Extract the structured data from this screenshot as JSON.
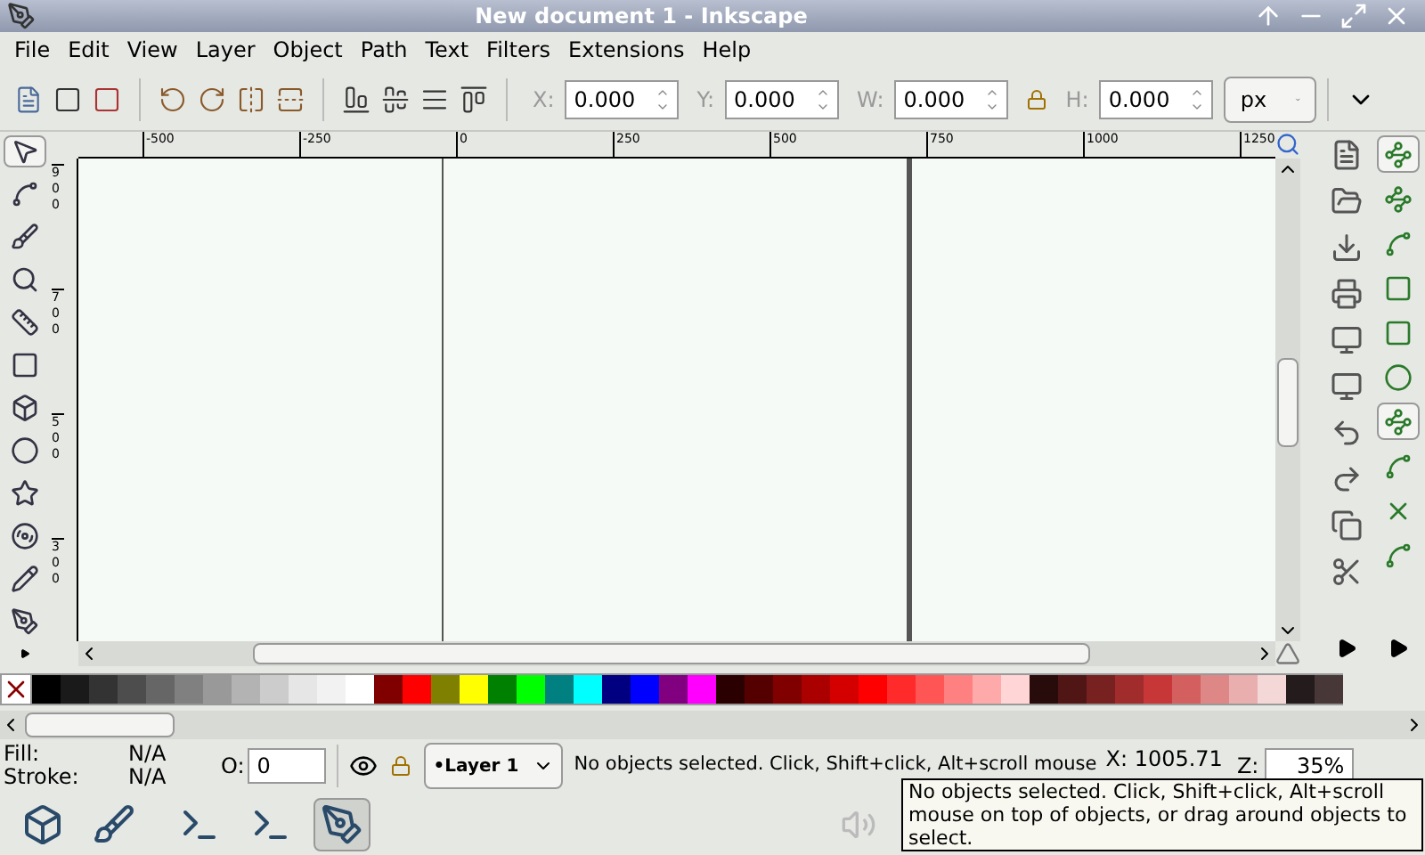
{
  "window": {
    "title": "New document 1 - Inkscape"
  },
  "menu": [
    "File",
    "Edit",
    "View",
    "Layer",
    "Object",
    "Path",
    "Text",
    "Filters",
    "Extensions",
    "Help"
  ],
  "toolbar": {
    "fields": [
      {
        "label": "X:",
        "value": "0.000"
      },
      {
        "label": "Y:",
        "value": "0.000"
      },
      {
        "label": "W:",
        "value": "0.000"
      },
      {
        "label": "H:",
        "value": "0.000"
      }
    ],
    "unit": "px"
  },
  "tools": [
    {
      "selected": true
    },
    {
      "selected": false
    },
    {
      "selected": false
    },
    {
      "selected": false
    },
    {
      "selected": false
    },
    {
      "selected": false
    },
    {
      "selected": false
    },
    {
      "selected": false
    },
    {
      "selected": false
    },
    {
      "selected": false
    },
    {
      "selected": false
    },
    {
      "selected": false
    }
  ],
  "ruler": {
    "horizontal": [
      "-500",
      "-250",
      "0",
      "250",
      "500",
      "750",
      "1000",
      "1250"
    ],
    "vertical": [
      "900",
      "700",
      "500",
      "300"
    ]
  },
  "snap": [
    {
      "selected": true
    },
    {
      "selected": false
    },
    {
      "selected": false
    },
    {
      "selected": false
    },
    {
      "selected": false
    },
    {
      "selected": false
    },
    {
      "selected": true
    },
    {
      "selected": false
    },
    {
      "selected": false
    },
    {
      "selected": false
    }
  ],
  "palette": [
    {
      "color": "#000000"
    },
    {
      "color": "#1a1a1a"
    },
    {
      "color": "#333333"
    },
    {
      "color": "#4d4d4d"
    },
    {
      "color": "#666666"
    },
    {
      "color": "#808080"
    },
    {
      "color": "#999999"
    },
    {
      "color": "#b3b3b3"
    },
    {
      "color": "#cccccc"
    },
    {
      "color": "#e6e6e6"
    },
    {
      "color": "#f2f2f2"
    },
    {
      "color": "#ffffff"
    },
    {
      "color": "#800000"
    },
    {
      "color": "#ff0000"
    },
    {
      "color": "#808000"
    },
    {
      "color": "#ffff00"
    },
    {
      "color": "#008000"
    },
    {
      "color": "#00ff00"
    },
    {
      "color": "#008080"
    },
    {
      "color": "#00ffff"
    },
    {
      "color": "#000080"
    },
    {
      "color": "#0000ff"
    },
    {
      "color": "#800080"
    },
    {
      "color": "#ff00ff"
    },
    {
      "color": "#2b0000"
    },
    {
      "color": "#550000"
    },
    {
      "color": "#800000"
    },
    {
      "color": "#aa0000"
    },
    {
      "color": "#d40000"
    },
    {
      "color": "#ff0000"
    },
    {
      "color": "#ff2a2a"
    },
    {
      "color": "#ff5555"
    },
    {
      "color": "#ff8080"
    },
    {
      "color": "#ffaaaa"
    },
    {
      "color": "#ffd5d5"
    },
    {
      "color": "#280b0b"
    },
    {
      "color": "#501616"
    },
    {
      "color": "#782121"
    },
    {
      "color": "#a02c2c"
    },
    {
      "color": "#c83737"
    },
    {
      "color": "#d35f5f"
    },
    {
      "color": "#de8787"
    },
    {
      "color": "#e9afaf"
    },
    {
      "color": "#f4d7d7"
    },
    {
      "color": "#241c1c"
    },
    {
      "color": "#483737"
    }
  ],
  "status": {
    "fill_label": "Fill:",
    "fill_value": "N/A",
    "stroke_label": "Stroke:",
    "stroke_value": "N/A",
    "opacity_label": "O:",
    "opacity_value": "0",
    "layer": "•Layer 1",
    "message": "No objects selected. Click, Shift+click, Alt+scroll mouse",
    "x": "X: 1005.71",
    "zoom_label": "Z:",
    "zoom_value": "35%"
  },
  "tooltip": "No objects selected. Click, Shift+click, Alt+scroll mouse on top of objects, or drag around objects to select.",
  "taskbar": [
    {
      "selected": false
    },
    {
      "selected": false
    },
    {
      "selected": false
    },
    {
      "selected": false
    },
    {
      "selected": true
    }
  ]
}
